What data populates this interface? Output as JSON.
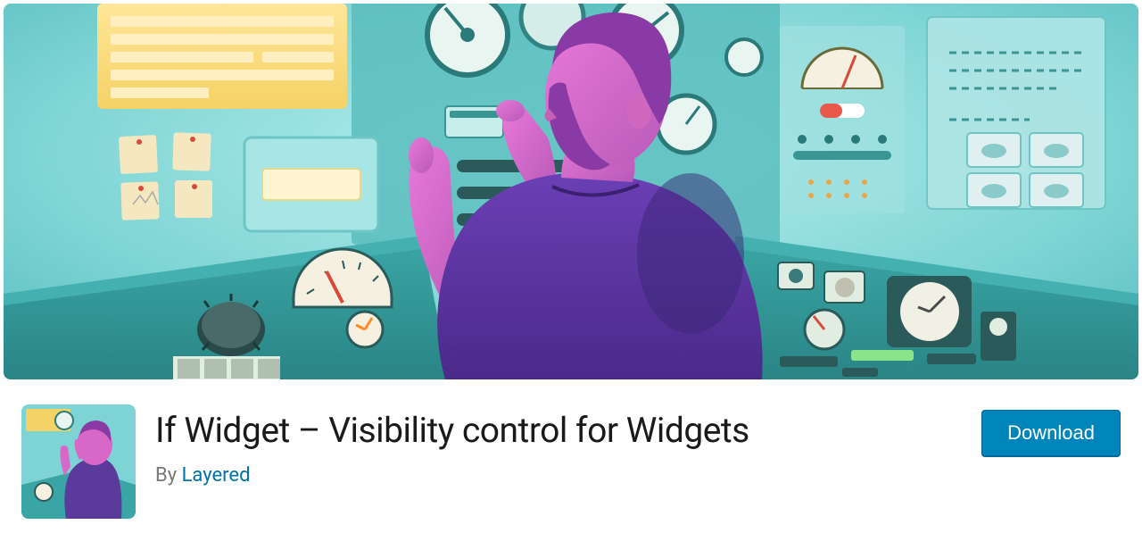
{
  "plugin": {
    "title": "If Widget – Visibility control for Widgets",
    "by_prefix": "By ",
    "author": "Layered",
    "download_label": "Download"
  }
}
